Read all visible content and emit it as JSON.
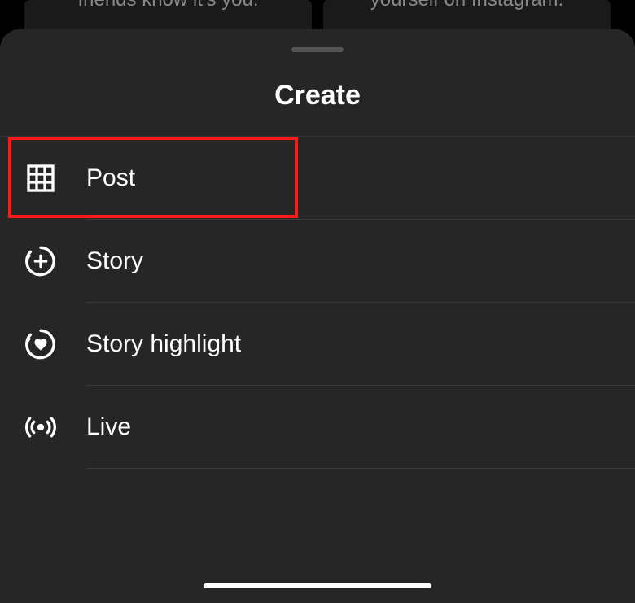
{
  "backdrop": {
    "left_text": "friends know it's you.",
    "right_text": "yourself on Instagram."
  },
  "sheet": {
    "title": "Create"
  },
  "menu": {
    "items": [
      {
        "label": "Post",
        "icon": "grid-icon",
        "highlighted": true
      },
      {
        "label": "Story",
        "icon": "story-plus-icon",
        "highlighted": false
      },
      {
        "label": "Story highlight",
        "icon": "story-heart-icon",
        "highlighted": false
      },
      {
        "label": "Live",
        "icon": "live-icon",
        "highlighted": false
      }
    ]
  },
  "annotation": {
    "highlight_color": "#ff1a1a"
  }
}
